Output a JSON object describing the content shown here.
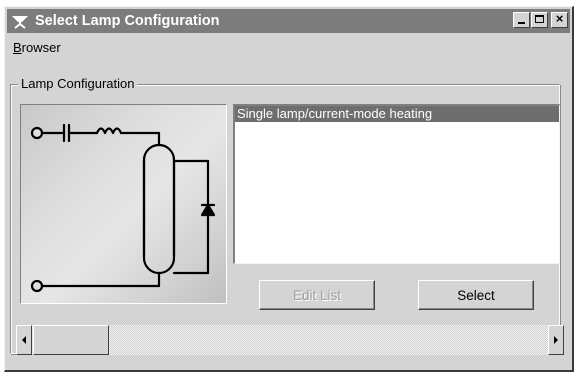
{
  "window": {
    "title": "Select Lamp Configuration",
    "icon": "lamp-icon"
  },
  "menu": {
    "items": [
      {
        "label_mnemonic": "B",
        "label_rest": "rowser"
      }
    ]
  },
  "group": {
    "label": "Lamp Configuration"
  },
  "diagram": {
    "icon": "lamp-circuit-diagram-icon"
  },
  "list": {
    "items": [
      "Single lamp/current-mode heating"
    ],
    "selected_index": 0
  },
  "buttons": {
    "edit_list": "Edit List",
    "select": "Select"
  },
  "scrollbar": {
    "position_fraction": 0.0
  },
  "colors": {
    "titlebar": "#7c7c7c",
    "face": "#d4d4d4",
    "selection": "#6e6e6e"
  }
}
